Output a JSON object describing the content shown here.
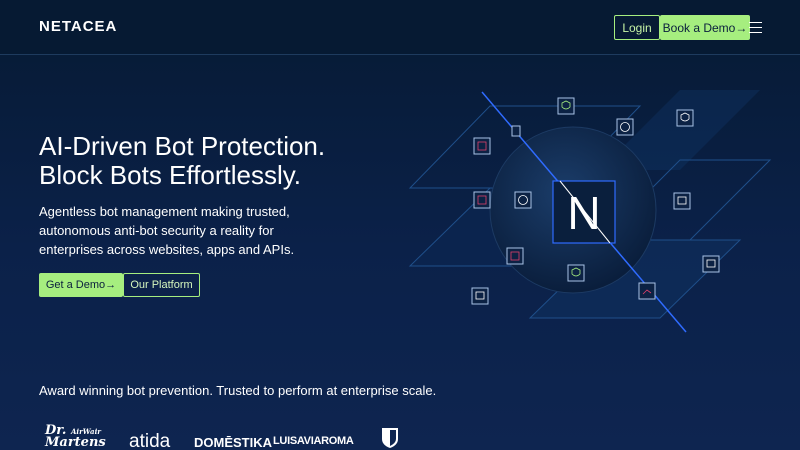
{
  "header": {
    "logo": "NETACEA",
    "login_label": "Login",
    "demo_label": "Book a Demo→",
    "menu_icon": "hamburger-menu-icon"
  },
  "hero": {
    "title_line1": "AI-Driven Bot Protection.",
    "title_line2": "Block Bots Effortlessly.",
    "subtitle": "Agentless bot management making trusted, autonomous anti-bot security a reality for enterprises across websites, apps and APIs.",
    "primary_button": "Get a Demo→",
    "secondary_button": "Our Platform"
  },
  "graphic": {
    "center_logo": "N",
    "icons": [
      "shield-check-icon",
      "user-icon",
      "robot-icon",
      "window-lock-icon",
      "chart-alert-icon"
    ]
  },
  "trusted": {
    "text": "Award winning bot prevention. Trusted to perform at enterprise scale.",
    "logos": {
      "drmartens_line1": "Dr.",
      "drmartens_line2": "Martens",
      "drmartens_tag": "AirWair",
      "atida": "atida",
      "domestika": "DOMĒSTIKA",
      "luisaviaroma": "LUISAVIAROMA"
    }
  },
  "colors": {
    "background": "#0b2149",
    "accent": "#a6ee7f",
    "line_blue": "#2f6bff"
  }
}
